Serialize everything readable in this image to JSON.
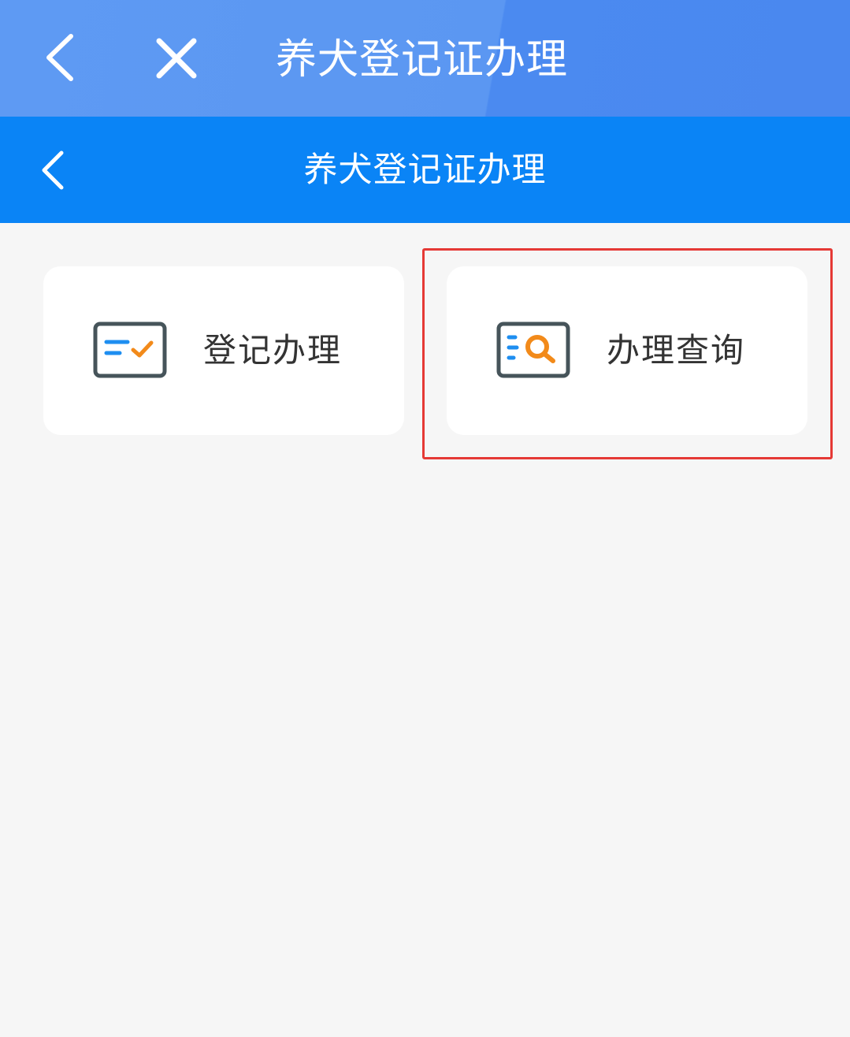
{
  "browser_bar": {
    "title": "养犬登记证办理",
    "back_icon": "chevron-left-icon",
    "close_icon": "close-icon"
  },
  "page_header": {
    "title": "养犬登记证办理",
    "back_icon": "chevron-left-icon"
  },
  "cards": [
    {
      "label": "登记办理",
      "icon": "registration-check-icon"
    },
    {
      "label": "办理查询",
      "icon": "search-document-icon"
    }
  ],
  "colors": {
    "browser_bar": "#5b97f2",
    "header_bar": "#0a84f6",
    "background": "#f6f6f6",
    "icon_frame": "#46545a",
    "icon_blue": "#1e8ef0",
    "icon_orange": "#f28a1a",
    "highlight": "#e53935"
  }
}
